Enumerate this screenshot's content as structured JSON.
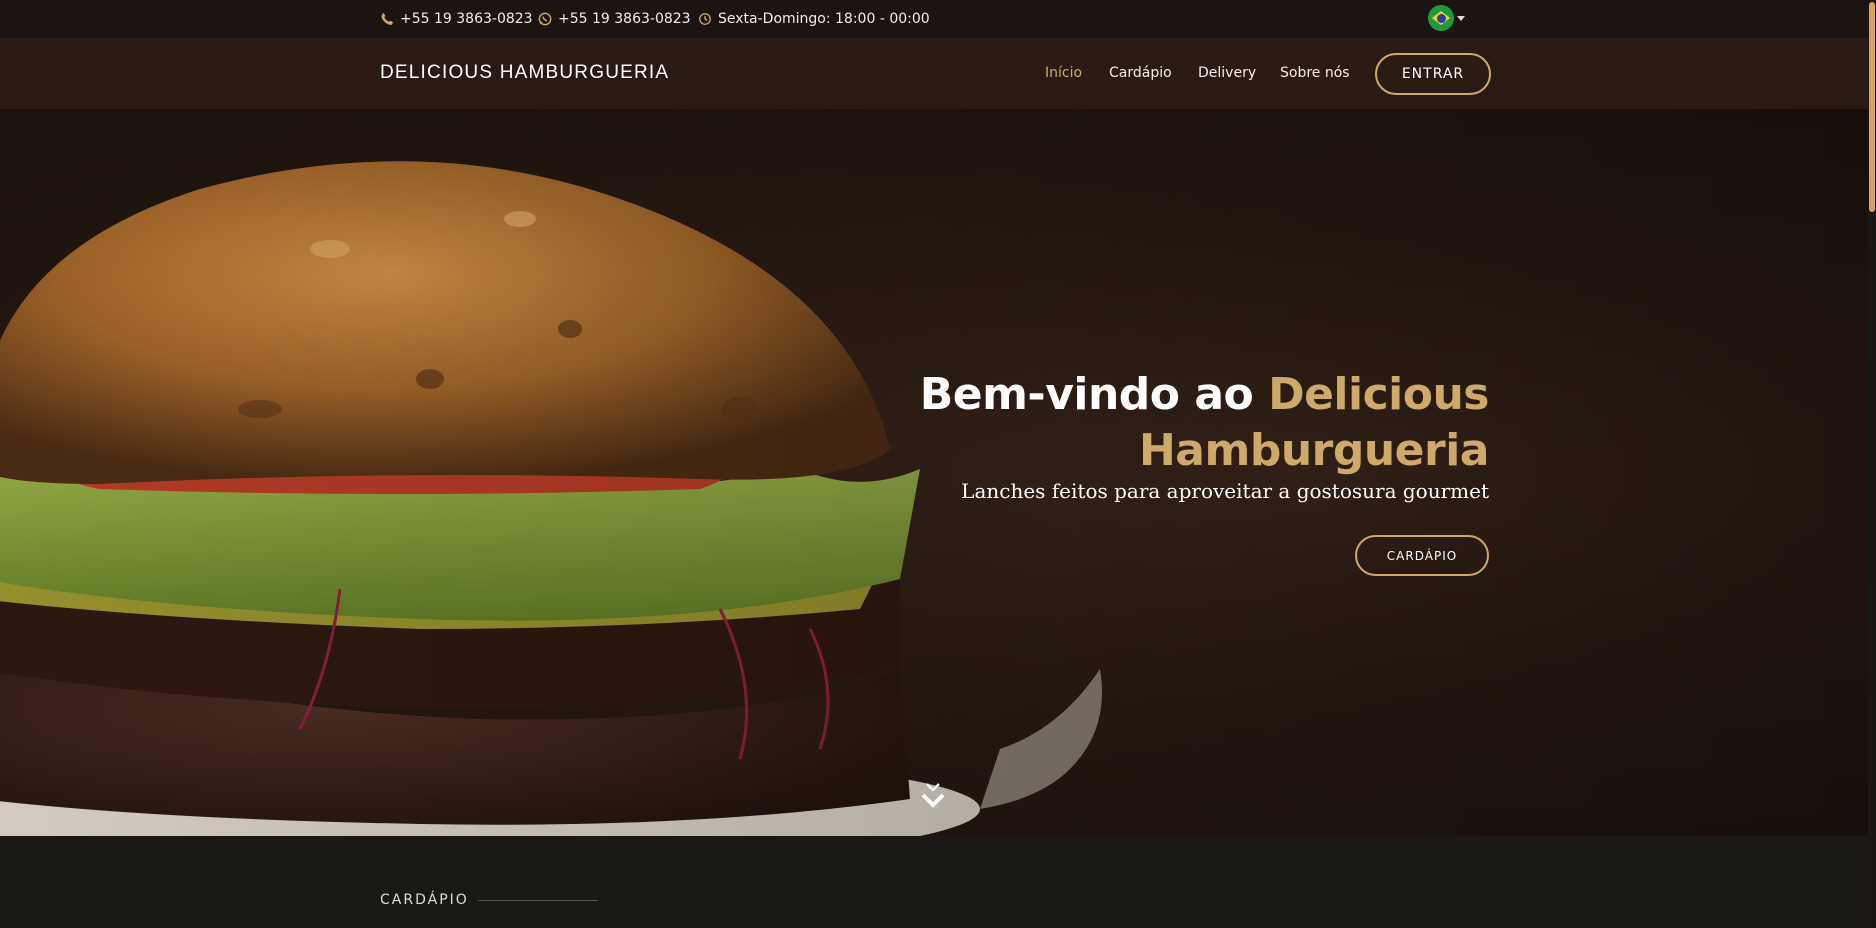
{
  "topbar": {
    "phone": "+55 19 3863-0823",
    "whatsapp": "+55 19 3863-0823",
    "hours": "Sexta-Domingo: 18:00 - 00:00",
    "language_flag": "brazil-flag-icon"
  },
  "navbar": {
    "brand": "DELICIOUS HAMBURGUERIA",
    "links": [
      {
        "label": "Início",
        "active": true
      },
      {
        "label": "Cardápio",
        "active": false
      },
      {
        "label": "Delivery",
        "active": false
      },
      {
        "label": "Sobre nós",
        "active": false
      }
    ],
    "login_label": "ENTRAR"
  },
  "hero": {
    "title_prefix": "Bem-vindo ao ",
    "title_accent_1": "Delicious",
    "title_accent_2": "Hamburgueria",
    "subtitle": "Lanches feitos para aproveitar a gostosura gourmet",
    "cta_label": "CARDÁPIO",
    "scroll_icon": "chevron-double-down-icon"
  },
  "section": {
    "label": "CARDÁPIO"
  },
  "colors": {
    "accent": "#cfa96a",
    "navbar": "#2a1a13",
    "topbar": "#1c1410",
    "section_bg": "#1a1814"
  }
}
